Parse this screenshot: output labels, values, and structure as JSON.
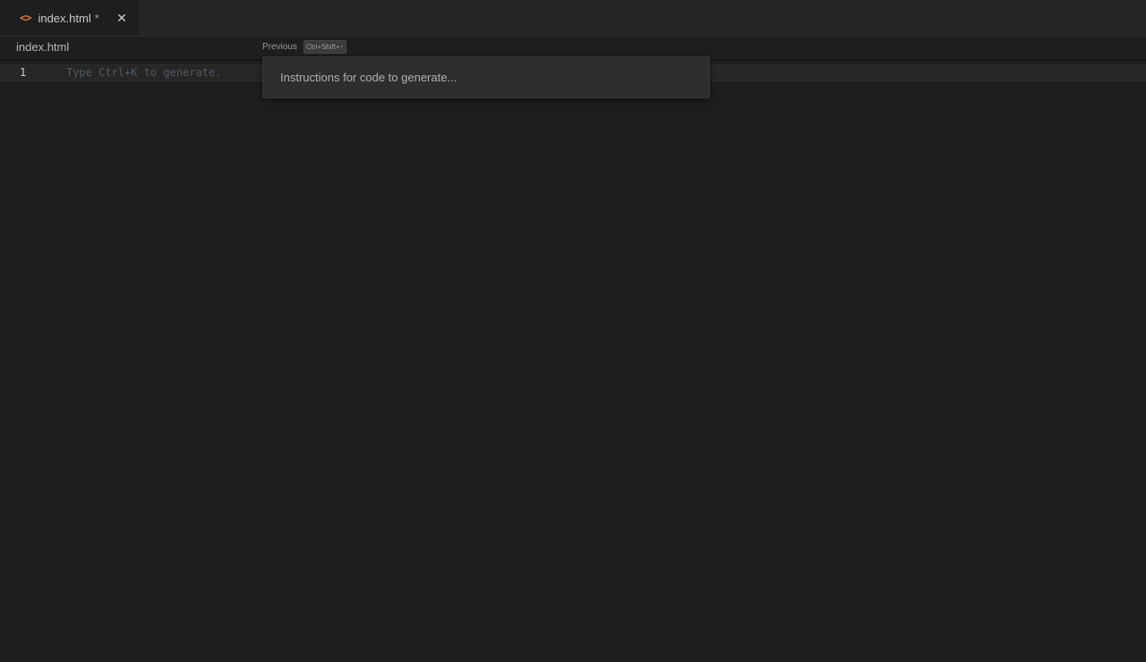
{
  "tabs": [
    {
      "icon": "html-file-icon",
      "icon_glyph": "<>",
      "label": "index.html",
      "dirty_marker": "*",
      "close_glyph": "✕"
    }
  ],
  "breadcrumb": {
    "file": "index.html"
  },
  "editor": {
    "line_number": "1",
    "placeholder": "Type Ctrl+K to generate."
  },
  "prompt": {
    "previous_label": "Previous",
    "previous_shortcut": "Ctrl+Shift+↑",
    "input_placeholder": "Instructions for code to generate...",
    "input_value": ""
  },
  "colors": {
    "background": "#1e1e1e",
    "tab_bar": "#252526",
    "html_icon": "#e37933",
    "prompt_box": "#2d2d2d"
  }
}
